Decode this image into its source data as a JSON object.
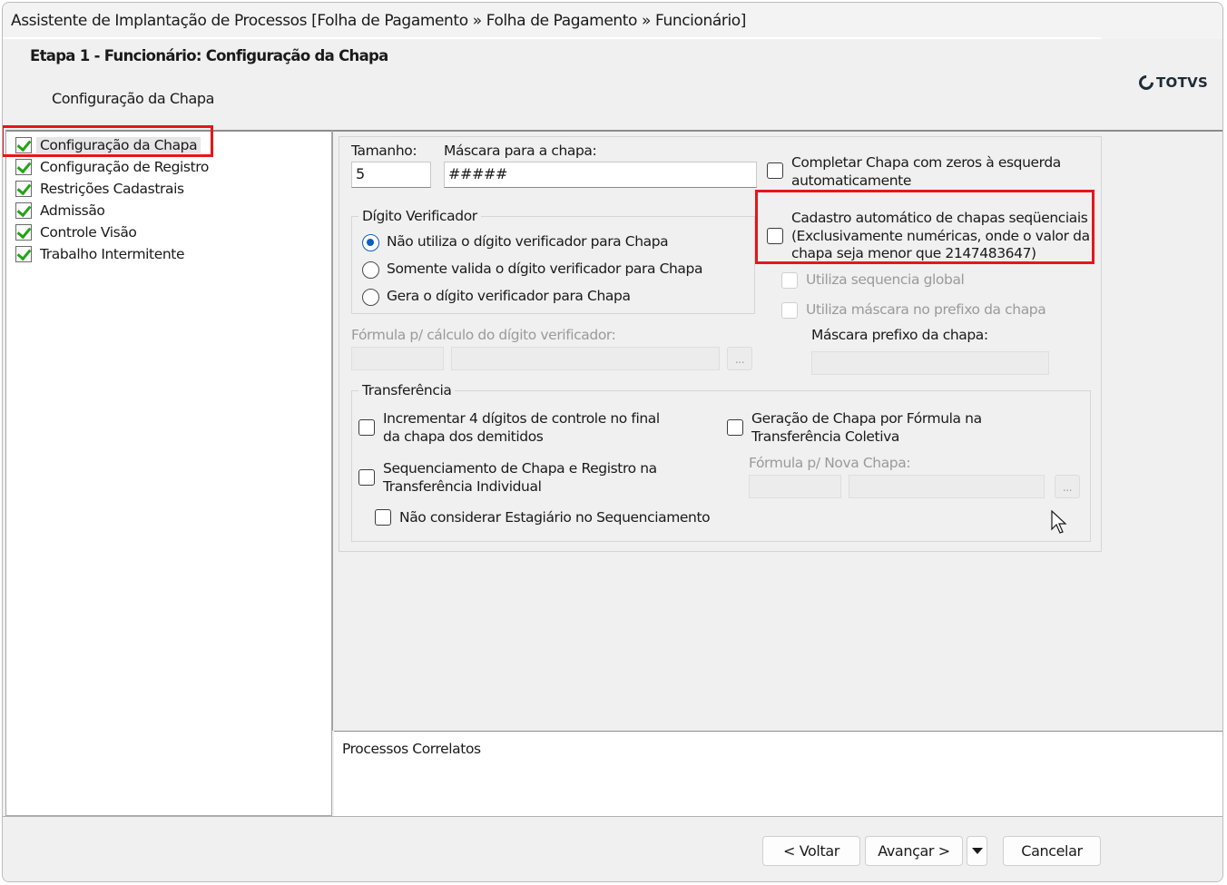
{
  "window": {
    "title": "Assistente de Implantação de Processos [Folha de Pagamento » Folha de Pagamento » Funcionário]"
  },
  "header": {
    "step_title": "Etapa 1 - Funcionário: Configuração da Chapa",
    "step_subtitle": "Configuração da Chapa",
    "logo_text": "TOTVS"
  },
  "sidebar": {
    "items": [
      {
        "label": "Configuração da Chapa",
        "selected": true
      },
      {
        "label": "Configuração de Registro"
      },
      {
        "label": "Restrições Cadastrais"
      },
      {
        "label": "Admissão"
      },
      {
        "label": "Controle Visão"
      },
      {
        "label": "Trabalho Intermitente"
      }
    ]
  },
  "form": {
    "tamanho_label": "Tamanho:",
    "tamanho_value": "5",
    "mascara_label": "Máscara para a chapa:",
    "mascara_value": "#####",
    "completar_label": "Completar Chapa com zeros à esquerda automaticamente",
    "completar_line1": "Completar Chapa com zeros à esquerda",
    "completar_line2": "automaticamente",
    "digito_group_label": "Dígito Verificador",
    "digito_options": [
      {
        "label": "Não utiliza o dígito verificador para Chapa",
        "checked": true
      },
      {
        "label": "Somente valida o dígito verificador para Chapa",
        "checked": false
      },
      {
        "label": "Gera o dígito verificador para Chapa",
        "checked": false
      }
    ],
    "cadastro_auto_line1": "Cadastro automático de chapas seqüenciais",
    "cadastro_auto_line2": "(Exclusivamente numéricas, onde o valor da",
    "cadastro_auto_line3": "chapa seja menor que 2147483647)",
    "utiliza_seq_global_label": "Utiliza sequencia global",
    "utiliza_mascara_prefixo_label": "Utiliza máscara no prefixo da chapa",
    "mascara_prefixo_label": "Máscara prefixo da chapa:",
    "formula_digito_label": "Fórmula p/ cálculo do dígito verificador:",
    "ellipsis": "...",
    "transferencia_group_label": "Transferência",
    "incrementar_line1": "Incrementar 4 dígitos de controle no final",
    "incrementar_line2": "da chapa dos demitidos",
    "sequenciamento_line1": "Sequenciamento de Chapa e Registro na",
    "sequenciamento_line2": "Transferência Individual",
    "nao_considerar_label": "Não considerar Estagiário no Sequenciamento",
    "geracao_line1": "Geração de Chapa por Fórmula na",
    "geracao_line2": "Transferência Coletiva",
    "formula_nova_chapa_label": "Fórmula p/ Nova Chapa:"
  },
  "related": {
    "label": "Processos Correlatos"
  },
  "footer": {
    "back_label": "< Voltar",
    "next_label": "Avançar >",
    "cancel_label": "Cancelar"
  },
  "colors": {
    "highlight_red": "#e5161c",
    "radio_blue": "#0a5fc4",
    "check_green": "#23a316"
  }
}
